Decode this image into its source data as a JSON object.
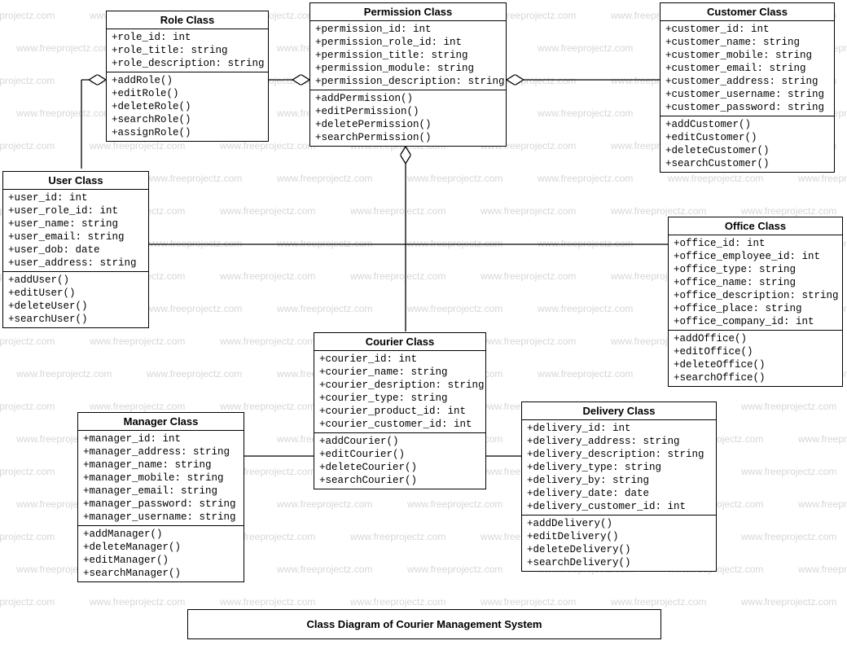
{
  "watermark_text": "www.freeprojectz.com",
  "footer_title": "Class Diagram of Courier Management System",
  "classes": {
    "role": {
      "title": "Role Class",
      "attrs": [
        "+role_id: int",
        "+role_title: string",
        "+role_description: string"
      ],
      "ops": [
        "+addRole()",
        "+editRole()",
        "+deleteRole()",
        "+searchRole()",
        "+assignRole()"
      ]
    },
    "permission": {
      "title": "Permission Class",
      "attrs": [
        "+permission_id: int",
        "+permission_role_id: int",
        "+permission_title: string",
        "+permission_module: string",
        "+permission_description: string"
      ],
      "ops": [
        "+addPermission()",
        "+editPermission()",
        "+deletePermission()",
        "+searchPermission()"
      ]
    },
    "customer": {
      "title": "Customer Class",
      "attrs": [
        "+customer_id: int",
        "+customer_name: string",
        "+customer_mobile: string",
        "+customer_email: string",
        "+customer_address: string",
        "+customer_username: string",
        "+customer_password: string"
      ],
      "ops": [
        "+addCustomer()",
        "+editCustomer()",
        "+deleteCustomer()",
        "+searchCustomer()"
      ]
    },
    "user": {
      "title": "User Class",
      "attrs": [
        "+user_id: int",
        "+user_role_id: int",
        "+user_name: string",
        "+user_email: string",
        "+user_dob: date",
        "+user_address: string"
      ],
      "ops": [
        "+addUser()",
        "+editUser()",
        "+deleteUser()",
        "+searchUser()"
      ]
    },
    "office": {
      "title": "Office Class",
      "attrs": [
        "+office_id: int",
        "+office_employee_id: int",
        "+office_type: string",
        "+office_name: string",
        "+office_description: string",
        "+office_place: string",
        "+office_company_id: int"
      ],
      "ops": [
        "+addOffice()",
        "+editOffice()",
        "+deleteOffice()",
        "+searchOffice()"
      ]
    },
    "courier": {
      "title": "Courier Class",
      "attrs": [
        "+courier_id: int",
        "+courier_name: string",
        "+courier_desription: string",
        "+courier_type: string",
        "+courier_product_id: int",
        "+courier_customer_id: int"
      ],
      "ops": [
        "+addCourier()",
        "+editCourier()",
        "+deleteCourier()",
        "+searchCourier()"
      ]
    },
    "manager": {
      "title": "Manager Class",
      "attrs": [
        "+manager_id: int",
        "+manager_address: string",
        "+manager_name: string",
        "+manager_mobile: string",
        "+manager_email: string",
        "+manager_password: string",
        "+manager_username: string"
      ],
      "ops": [
        "+addManager()",
        "+deleteManager()",
        "+editManager()",
        "+searchManager()"
      ]
    },
    "delivery": {
      "title": "Delivery Class",
      "attrs": [
        "+delivery_id: int",
        "+delivery_address: string",
        "+delivery_description: string",
        "+delivery_type: string",
        "+delivery_by: string",
        "+delivery_date: date",
        "+delivery_customer_id: int"
      ],
      "ops": [
        "+addDelivery()",
        "+editDelivery()",
        "+deleteDelivery()",
        "+searchDelivery()"
      ]
    }
  }
}
